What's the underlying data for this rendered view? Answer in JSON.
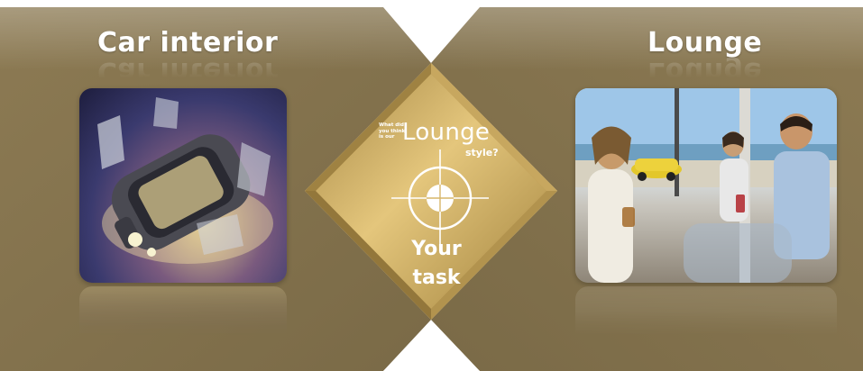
{
  "panels": {
    "left": {
      "title": "Car interior",
      "image": "car-interior-photo"
    },
    "right": {
      "title": "Lounge",
      "image": "lounge-photo"
    }
  },
  "center": {
    "question_small": "What did you think is our",
    "question_main": "Lounge",
    "question_suffix": "style?",
    "task_line1": "Your",
    "task_line2": "task",
    "icon": "crosshair-target-icon"
  },
  "colors": {
    "panel_brown": "#8c7a53",
    "panel_brown_dark": "#6f5f3f",
    "diamond_gold": "#c9a45a",
    "diamond_gold_light": "#e7c77f",
    "background": "#ffffff"
  }
}
